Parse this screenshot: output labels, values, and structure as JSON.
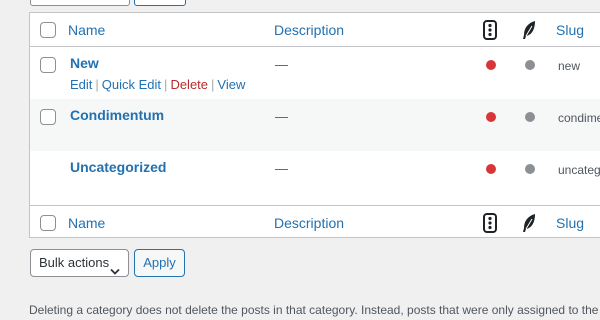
{
  "columns": {
    "name": "Name",
    "description": "Description",
    "slug": "Slug"
  },
  "icons": {
    "comments": "comment-bubble-icon",
    "feather": "feather-icon"
  },
  "categories": [
    {
      "name": "New",
      "description": "—",
      "slug": "new",
      "status_color": "#d63638"
    },
    {
      "name": "Condimentum",
      "description": "—",
      "slug": "condime",
      "status_color": "#d63638"
    },
    {
      "name": "Uncategorized",
      "description": "—",
      "slug": "uncateg",
      "status_color": "#d63638"
    }
  ],
  "row_actions": {
    "edit": "Edit",
    "quick_edit": "Quick Edit",
    "delete": "Delete",
    "view": "View",
    "separator": "|"
  },
  "bulk": {
    "select_value": "Bulk actions",
    "apply_label": "Apply"
  },
  "footer_note": "Deleting a category does not delete the posts in that category. Instead, posts that were only assigned to the",
  "colors": {
    "link": "#2271b1",
    "danger": "#b32d2e",
    "status_red": "#d63638",
    "status_grey": "#8c8f94"
  }
}
